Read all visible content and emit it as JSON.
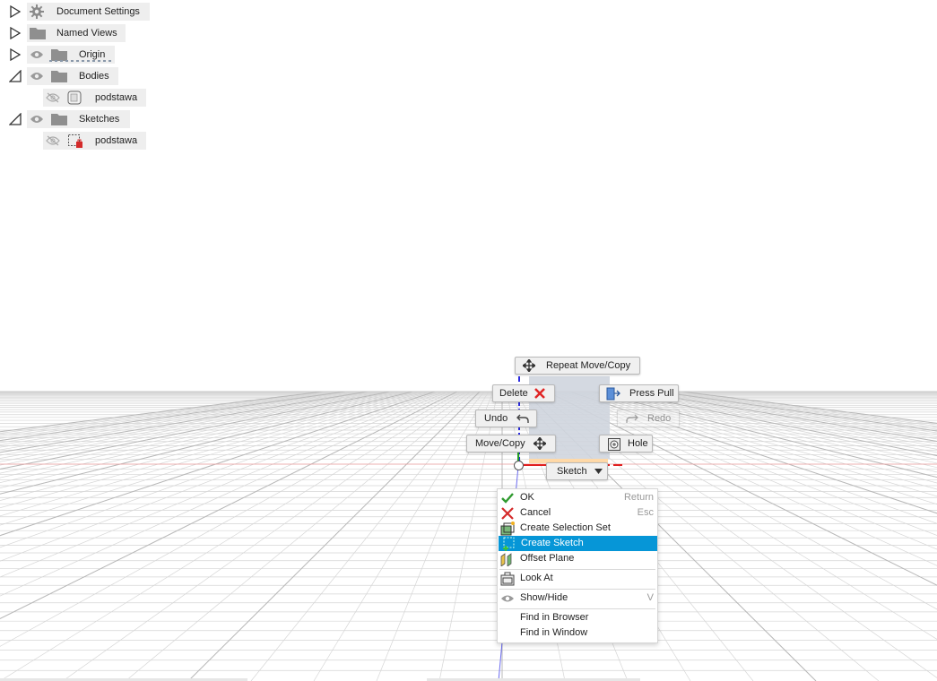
{
  "browser": {
    "items": [
      {
        "label": "Document Settings",
        "icon": "gear-icon",
        "expander": "collapsed"
      },
      {
        "label": "Named Views",
        "icon": "folder-icon",
        "expander": "collapsed"
      },
      {
        "label": "Origin",
        "icon": "folder-icon",
        "expander": "collapsed",
        "visibility": "eye-icon"
      },
      {
        "label": "Bodies",
        "icon": "folder-icon",
        "expander": "expanded",
        "visibility": "eye-icon"
      },
      {
        "label": "podstawa",
        "icon": "body-icon",
        "visibility": "eye-hidden-icon"
      },
      {
        "label": "Sketches",
        "icon": "folder-icon",
        "expander": "expanded",
        "visibility": "eye-icon"
      },
      {
        "label": "podstawa",
        "icon": "sketch-icon",
        "visibility": "eye-hidden-icon"
      }
    ]
  },
  "marking_menu": {
    "repeat": "Repeat Move/Copy",
    "delete": "Delete",
    "press_pull": "Press Pull",
    "undo": "Undo",
    "redo": "Redo",
    "move_copy": "Move/Copy",
    "hole": "Hole",
    "sketch": "Sketch"
  },
  "context_menu": {
    "items": [
      {
        "label": "OK",
        "shortcut": "Return",
        "icon": "check-icon"
      },
      {
        "label": "Cancel",
        "shortcut": "Esc",
        "icon": "cross-icon"
      },
      {
        "label": "Create Selection Set",
        "shortcut": "",
        "icon": "selection-set-icon"
      },
      {
        "label": "Create Sketch",
        "shortcut": "",
        "icon": "create-sketch-icon",
        "highlighted": true
      },
      {
        "label": "Offset Plane",
        "shortcut": "",
        "icon": "offset-plane-icon"
      },
      {
        "label": "Look At",
        "shortcut": "",
        "icon": "look-at-icon"
      },
      {
        "label": "Show/Hide",
        "shortcut": "V",
        "icon": "eye-icon"
      },
      {
        "label": "Find in Browser",
        "shortcut": ""
      },
      {
        "label": "Find in Window",
        "shortcut": ""
      }
    ]
  },
  "colors": {
    "highlight": "#0696d7",
    "x_axis": "#e02020",
    "z_axis": "#2a2ae0",
    "y_axis": "#20a020"
  }
}
